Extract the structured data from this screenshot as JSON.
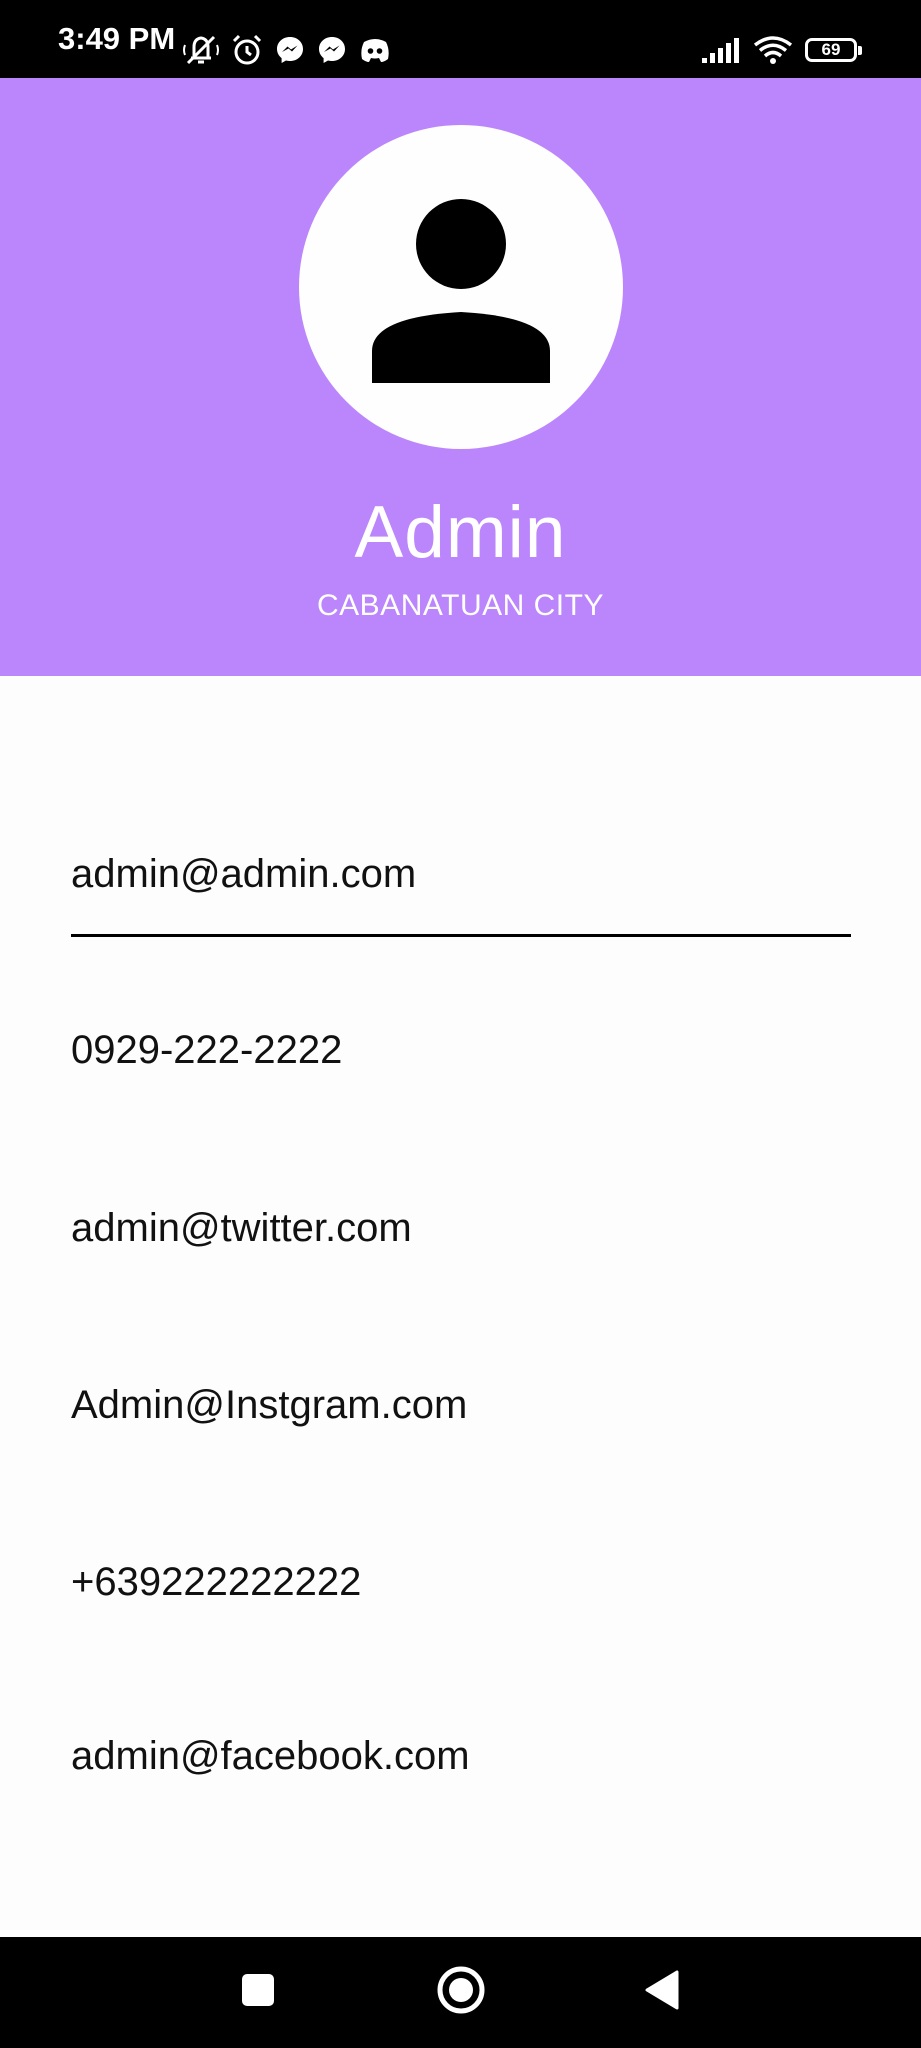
{
  "status_bar": {
    "time": "3:49 PM",
    "battery_level": "69",
    "icons_left": [
      "mute-icon",
      "alarm-icon",
      "messenger-icon",
      "messenger-icon",
      "discord-icon"
    ],
    "icons_right": [
      "signal-icon",
      "wifi-icon",
      "battery-icon"
    ]
  },
  "profile": {
    "name": "Admin",
    "city": "CABANATUAN CITY",
    "header_color": "#bb86fc",
    "avatar_icon": "person-icon"
  },
  "info": {
    "email": "admin@admin.com",
    "phone": "0929-222-2222",
    "twitter": "admin@twitter.com",
    "instagram": "Admin@Instgram.com",
    "mobile": "+639222222222",
    "facebook": "admin@facebook.com"
  },
  "nav_bar": {
    "buttons": [
      "recents-square-icon",
      "home-circle-icon",
      "back-triangle-icon"
    ]
  }
}
